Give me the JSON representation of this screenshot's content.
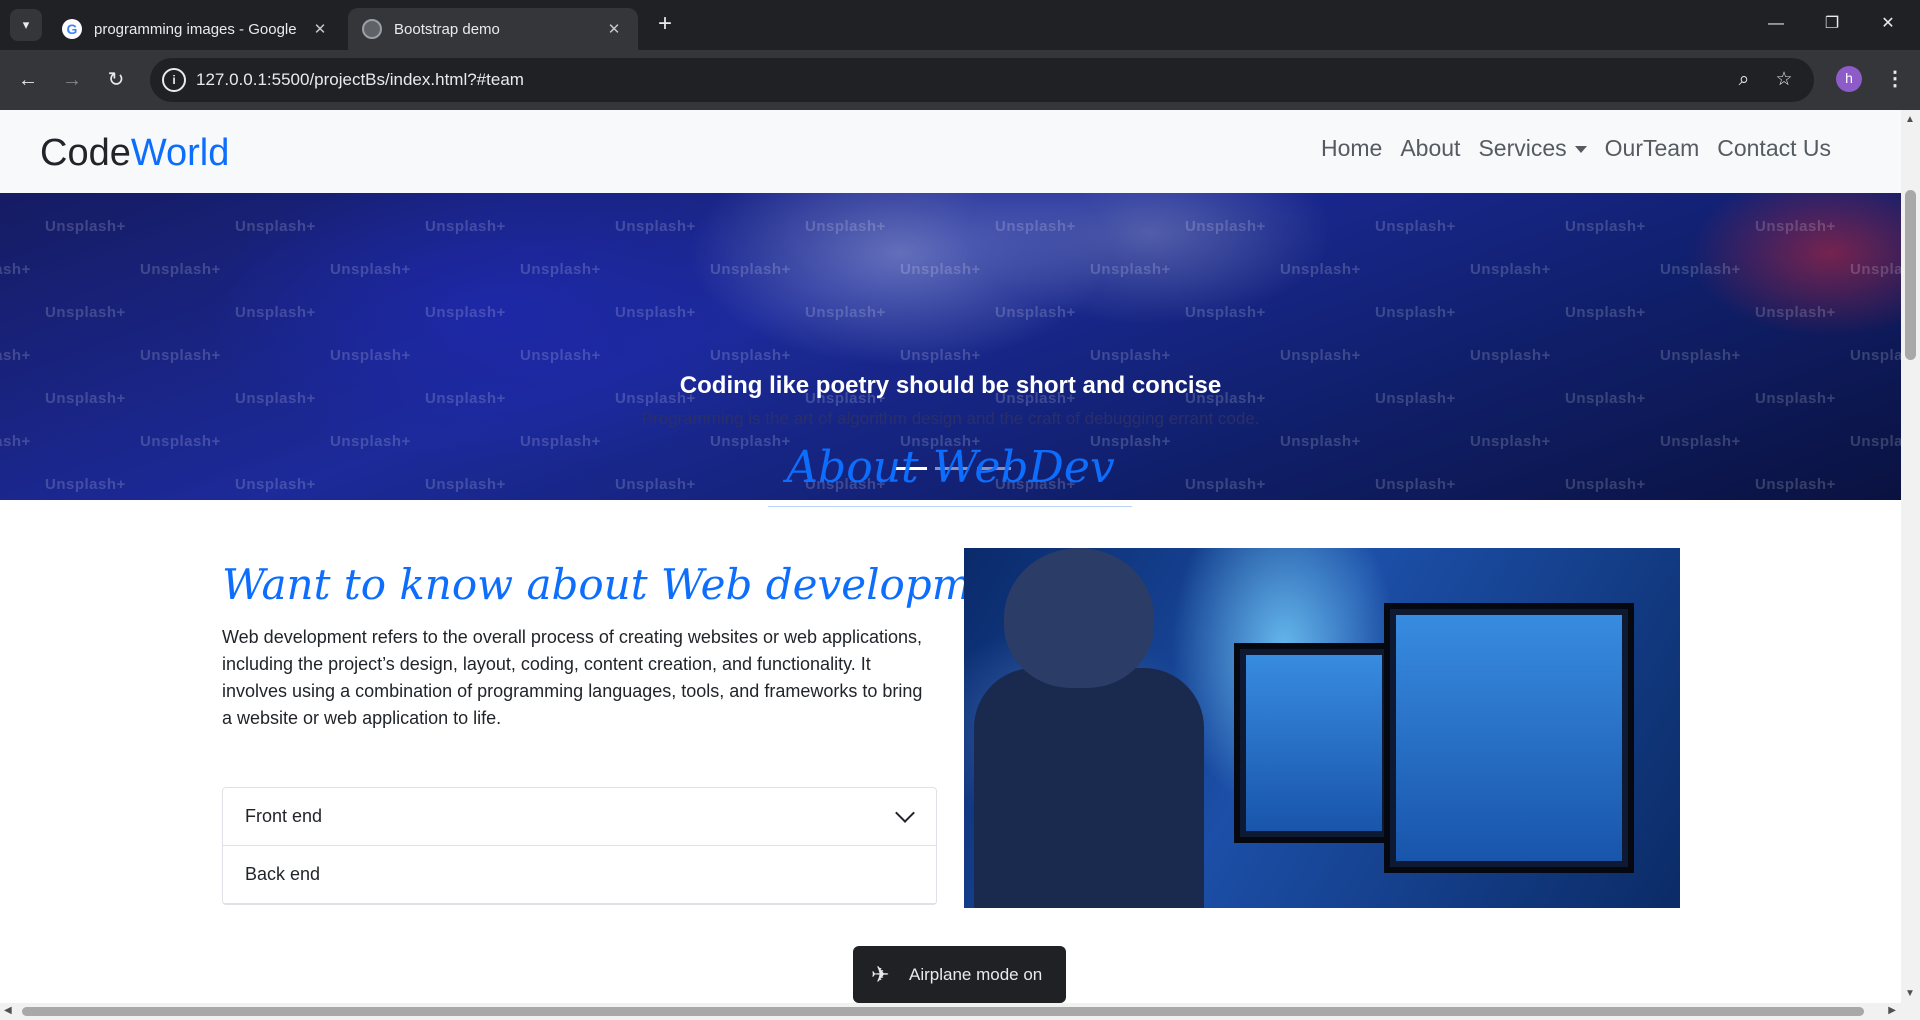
{
  "browser": {
    "tabs": [
      {
        "title": "programming images - Google",
        "active": false
      },
      {
        "title": "Bootstrap demo",
        "active": true
      }
    ],
    "new_tab_label": "+",
    "url": "127.0.0.1:5500/projectBs/index.html?#team",
    "window_controls": {
      "minimize": "—",
      "restore": "❐",
      "close": "✕"
    },
    "profile_initial": "h",
    "icons": [
      "tab-search-icon",
      "back-icon",
      "forward-icon",
      "reload-icon",
      "site-info-icon",
      "zoom-icon",
      "bookmark-star-icon",
      "menu-kebab-icon"
    ]
  },
  "site": {
    "brand_part1": "Code",
    "brand_part2": "World",
    "nav": [
      "Home",
      "About",
      "Services",
      "OurTeam",
      "Contact Us"
    ],
    "hero": {
      "watermark": "Unsplash+",
      "title": "Coding like poetry should be short and concise",
      "subtitle": "Programming is the art of algorithm design and the craft of debugging errant code.",
      "slides": 3,
      "active_slide": 1
    },
    "about_heading": "About WebDev",
    "about_title": "Want to know about Web development",
    "about_text": "Web development refers to the overall process of creating websites or web applications, including the project’s design, layout, coding, content creation, and functionality. It involves using a combination of programming languages, tools, and frameworks to bring a website or web application to life.",
    "accordion": [
      "Front end",
      "Back end"
    ]
  },
  "toast": {
    "text": "Airplane mode on",
    "icon": "airplane-icon"
  },
  "colors": {
    "brand_blue": "#0d6efd",
    "chrome_dark": "#202124",
    "chrome_mid": "#35363a"
  }
}
